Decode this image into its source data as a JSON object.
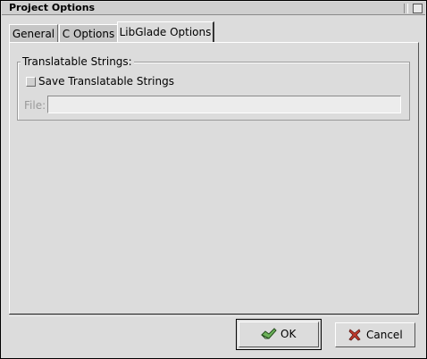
{
  "window": {
    "title": "Project Options"
  },
  "tabs": [
    {
      "label": "General",
      "active": false
    },
    {
      "label": "C Options",
      "active": false
    },
    {
      "label": "LibGlade Options",
      "active": true
    }
  ],
  "translatable": {
    "frame_label": "Translatable Strings:",
    "checkbox_label": "Save Translatable Strings",
    "checked": false,
    "file_label": "File:",
    "file_value": ""
  },
  "buttons": {
    "ok_label": "OK",
    "cancel_label": "Cancel"
  },
  "icons": {
    "ok": "ok-check-icon",
    "cancel": "cancel-x-icon"
  },
  "colors": {
    "background": "#dcdcdc",
    "cancel_icon": "#c0392b",
    "ok_icon": "#3c8c2e"
  }
}
